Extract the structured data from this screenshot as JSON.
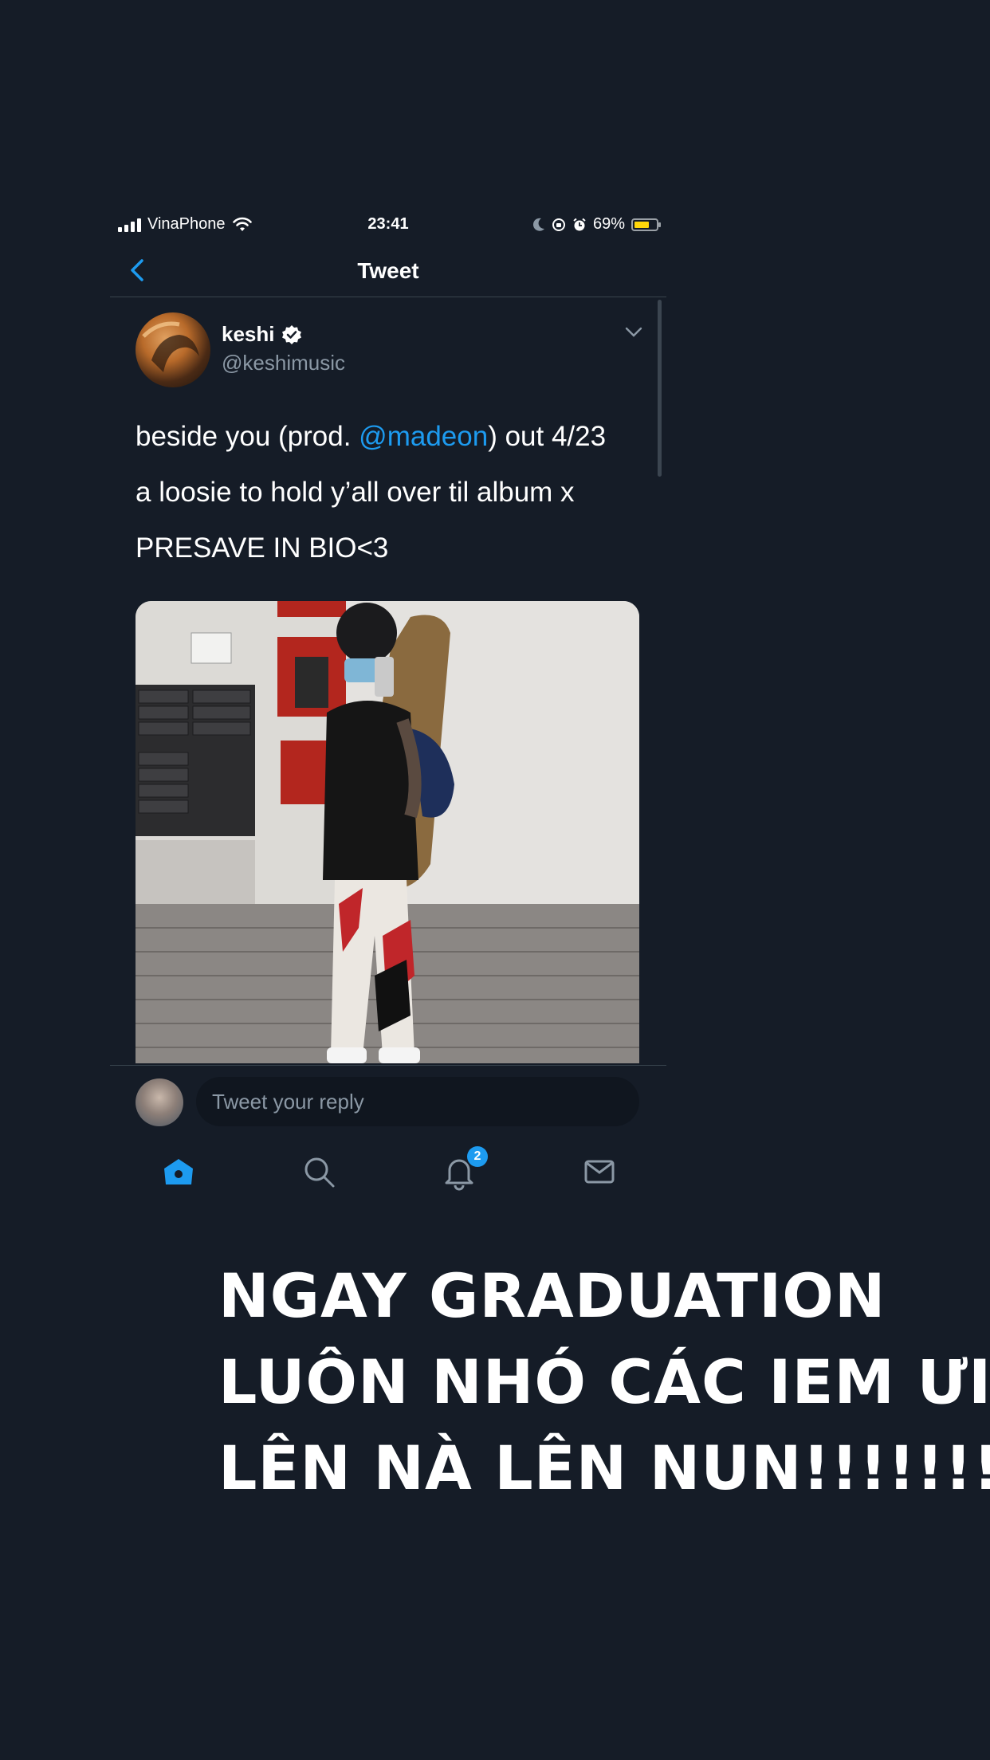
{
  "status_bar": {
    "carrier": "VinaPhone",
    "time": "23:41",
    "battery": "69%",
    "battery_level": 0.69
  },
  "nav": {
    "title": "Tweet"
  },
  "tweet": {
    "author_name": "keshi",
    "handle": "@keshimusic",
    "line1_prefix": "beside you (prod. ",
    "line1_mention": "@madeon",
    "line1_suffix": ") out 4/23",
    "line2": "a loosie to hold y’all over til album x",
    "line3": "PRESAVE IN BIO<3"
  },
  "reply": {
    "placeholder": "Tweet your reply"
  },
  "tabs": {
    "notifications_badge": "2"
  },
  "caption": {
    "line1": "NGAY GRADUATION",
    "line2": "LUÔN NHÓ CÁC IEM ƯI",
    "line3": "LÊN NÀ LÊN NUN!!!!!!!!"
  },
  "colors": {
    "background": "#151c27",
    "accent": "#1d9bf0",
    "secondary_text": "#8b98a5"
  }
}
